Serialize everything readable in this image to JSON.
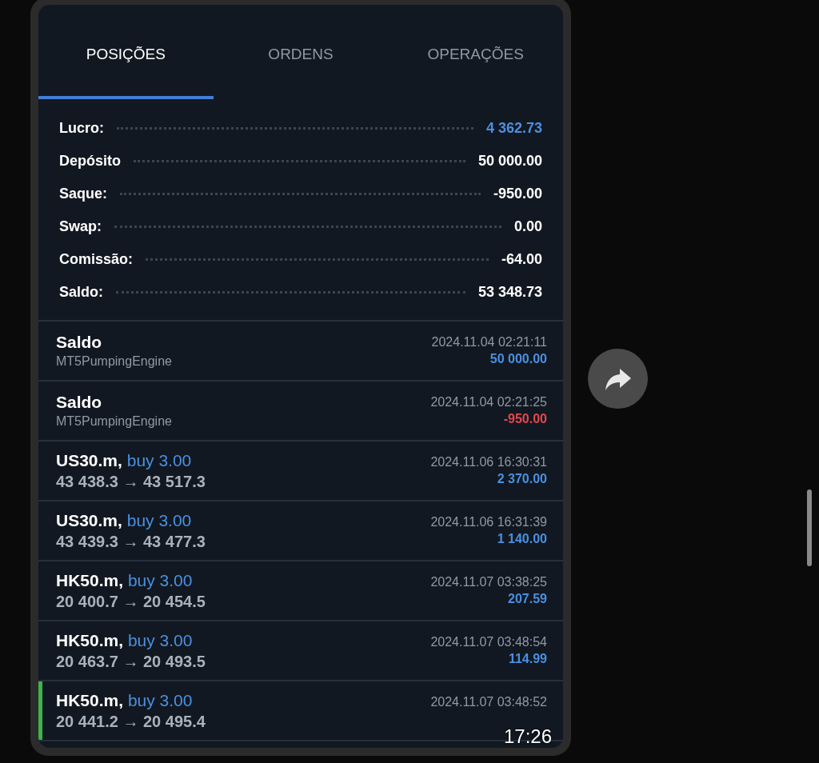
{
  "tabs": [
    {
      "label": "POSIÇÕES",
      "selected": true
    },
    {
      "label": "ORDENS",
      "selected": false
    },
    {
      "label": "OPERAÇÕES",
      "selected": false
    }
  ],
  "summary": [
    {
      "label": "Lucro:",
      "value": "4 362.73",
      "accent": true
    },
    {
      "label": "Depósito",
      "value": "50 000.00",
      "accent": false
    },
    {
      "label": "Saque:",
      "value": "-950.00",
      "accent": false
    },
    {
      "label": "Swap:",
      "value": "0.00",
      "accent": false
    },
    {
      "label": "Comissão:",
      "value": "-64.00",
      "accent": false
    },
    {
      "label": "Saldo:",
      "value": "53 348.73",
      "accent": false
    }
  ],
  "deals": [
    {
      "kind": "balance",
      "title": "Saldo",
      "subtitle": "MT5PumpingEngine",
      "time": "2024.11.04 02:21:11",
      "amount": "50 000.00",
      "loss": false,
      "marked": false
    },
    {
      "kind": "balance",
      "title": "Saldo",
      "subtitle": "MT5PumpingEngine",
      "time": "2024.11.04 02:21:25",
      "amount": "-950.00",
      "loss": true,
      "marked": false
    },
    {
      "kind": "trade",
      "symbol": "US30.m,",
      "side": "buy 3.00",
      "prices": "43 438.3 → 43 517.3",
      "time": "2024.11.06 16:30:31",
      "amount": "2 370.00",
      "loss": false,
      "marked": false
    },
    {
      "kind": "trade",
      "symbol": "US30.m,",
      "side": "buy 3.00",
      "prices": "43 439.3 → 43 477.3",
      "time": "2024.11.06 16:31:39",
      "amount": "1 140.00",
      "loss": false,
      "marked": false
    },
    {
      "kind": "trade",
      "symbol": "HK50.m,",
      "side": "buy 3.00",
      "prices": "20 400.7 → 20 454.5",
      "time": "2024.11.07 03:38:25",
      "amount": "207.59",
      "loss": false,
      "marked": false
    },
    {
      "kind": "trade",
      "symbol": "HK50.m,",
      "side": "buy 3.00",
      "prices": "20 463.7 → 20 493.5",
      "time": "2024.11.07 03:48:54",
      "amount": "114.99",
      "loss": false,
      "marked": false
    },
    {
      "kind": "trade",
      "symbol": "HK50.m,",
      "side": "buy 3.00",
      "prices": "20 441.2 → 20 495.4",
      "time": "2024.11.07 03:48:52",
      "marked": true
    }
  ],
  "message": {
    "time": "17:26"
  }
}
